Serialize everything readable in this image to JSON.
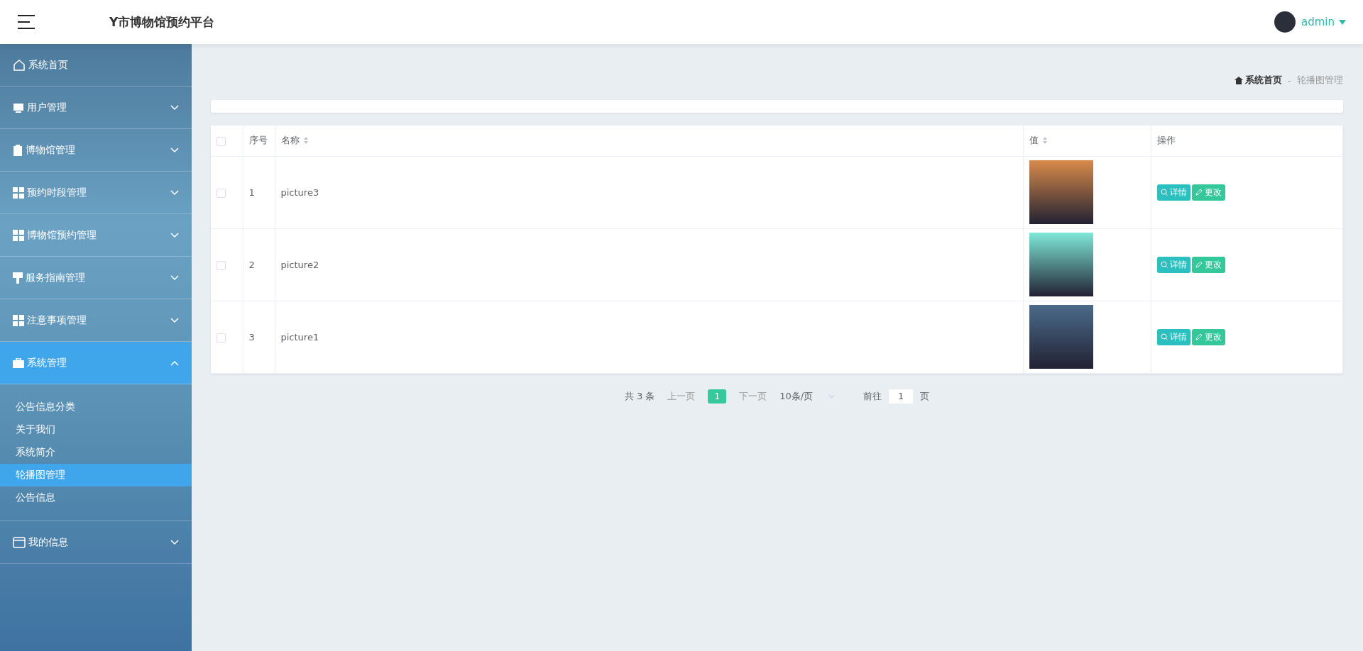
{
  "header": {
    "title": "Y市博物馆预约平台",
    "user": "admin"
  },
  "sidebar": {
    "items": [
      {
        "label": "系统首页",
        "kind": "link",
        "selected": false
      },
      {
        "label": "用户管理",
        "kind": "menu",
        "expanded": false,
        "selected": false
      },
      {
        "label": "博物馆管理",
        "kind": "menu",
        "expanded": false,
        "selected": false
      },
      {
        "label": "预约时段管理",
        "kind": "menu",
        "expanded": false,
        "selected": false
      },
      {
        "label": "博物馆预约管理",
        "kind": "menu",
        "expanded": false,
        "selected": false
      },
      {
        "label": "服务指南管理",
        "kind": "menu",
        "expanded": false,
        "selected": false
      },
      {
        "label": "注意事项管理",
        "kind": "menu",
        "expanded": false,
        "selected": false
      },
      {
        "label": "系统管理",
        "kind": "menu",
        "expanded": true,
        "selected": true,
        "children": [
          {
            "label": "公告信息分类",
            "selected": false
          },
          {
            "label": "关于我们",
            "selected": false
          },
          {
            "label": "系统简介",
            "selected": false
          },
          {
            "label": "轮播图管理",
            "selected": true
          },
          {
            "label": "公告信息",
            "selected": false
          }
        ]
      },
      {
        "label": "我的信息",
        "kind": "menu",
        "expanded": false,
        "selected": false
      }
    ]
  },
  "breadcrumb": {
    "home": "系统首页",
    "separator": "-",
    "current": "轮播图管理"
  },
  "table": {
    "columns": [
      {
        "label": "序号",
        "sortable": false
      },
      {
        "label": "名称",
        "sortable": true
      },
      {
        "label": "值",
        "sortable": true
      },
      {
        "label": "操作",
        "sortable": false
      }
    ],
    "header_checked": false,
    "rows": [
      {
        "checked": false,
        "index": "1",
        "name": "picture3",
        "actions": [
          "详情",
          "更改"
        ]
      },
      {
        "checked": false,
        "index": "2",
        "name": "picture2",
        "actions": [
          "详情",
          "更改"
        ]
      },
      {
        "checked": false,
        "index": "3",
        "name": "picture1",
        "actions": [
          "详情",
          "更改"
        ]
      }
    ]
  },
  "pagination": {
    "total": "共 3 条",
    "prev": "上一页",
    "pages": [
      {
        "label": "1",
        "selected": true
      }
    ],
    "next": "下一页",
    "page_size": "10条/页",
    "goto": "前往",
    "goto_value": "1",
    "page_unit": "页"
  }
}
